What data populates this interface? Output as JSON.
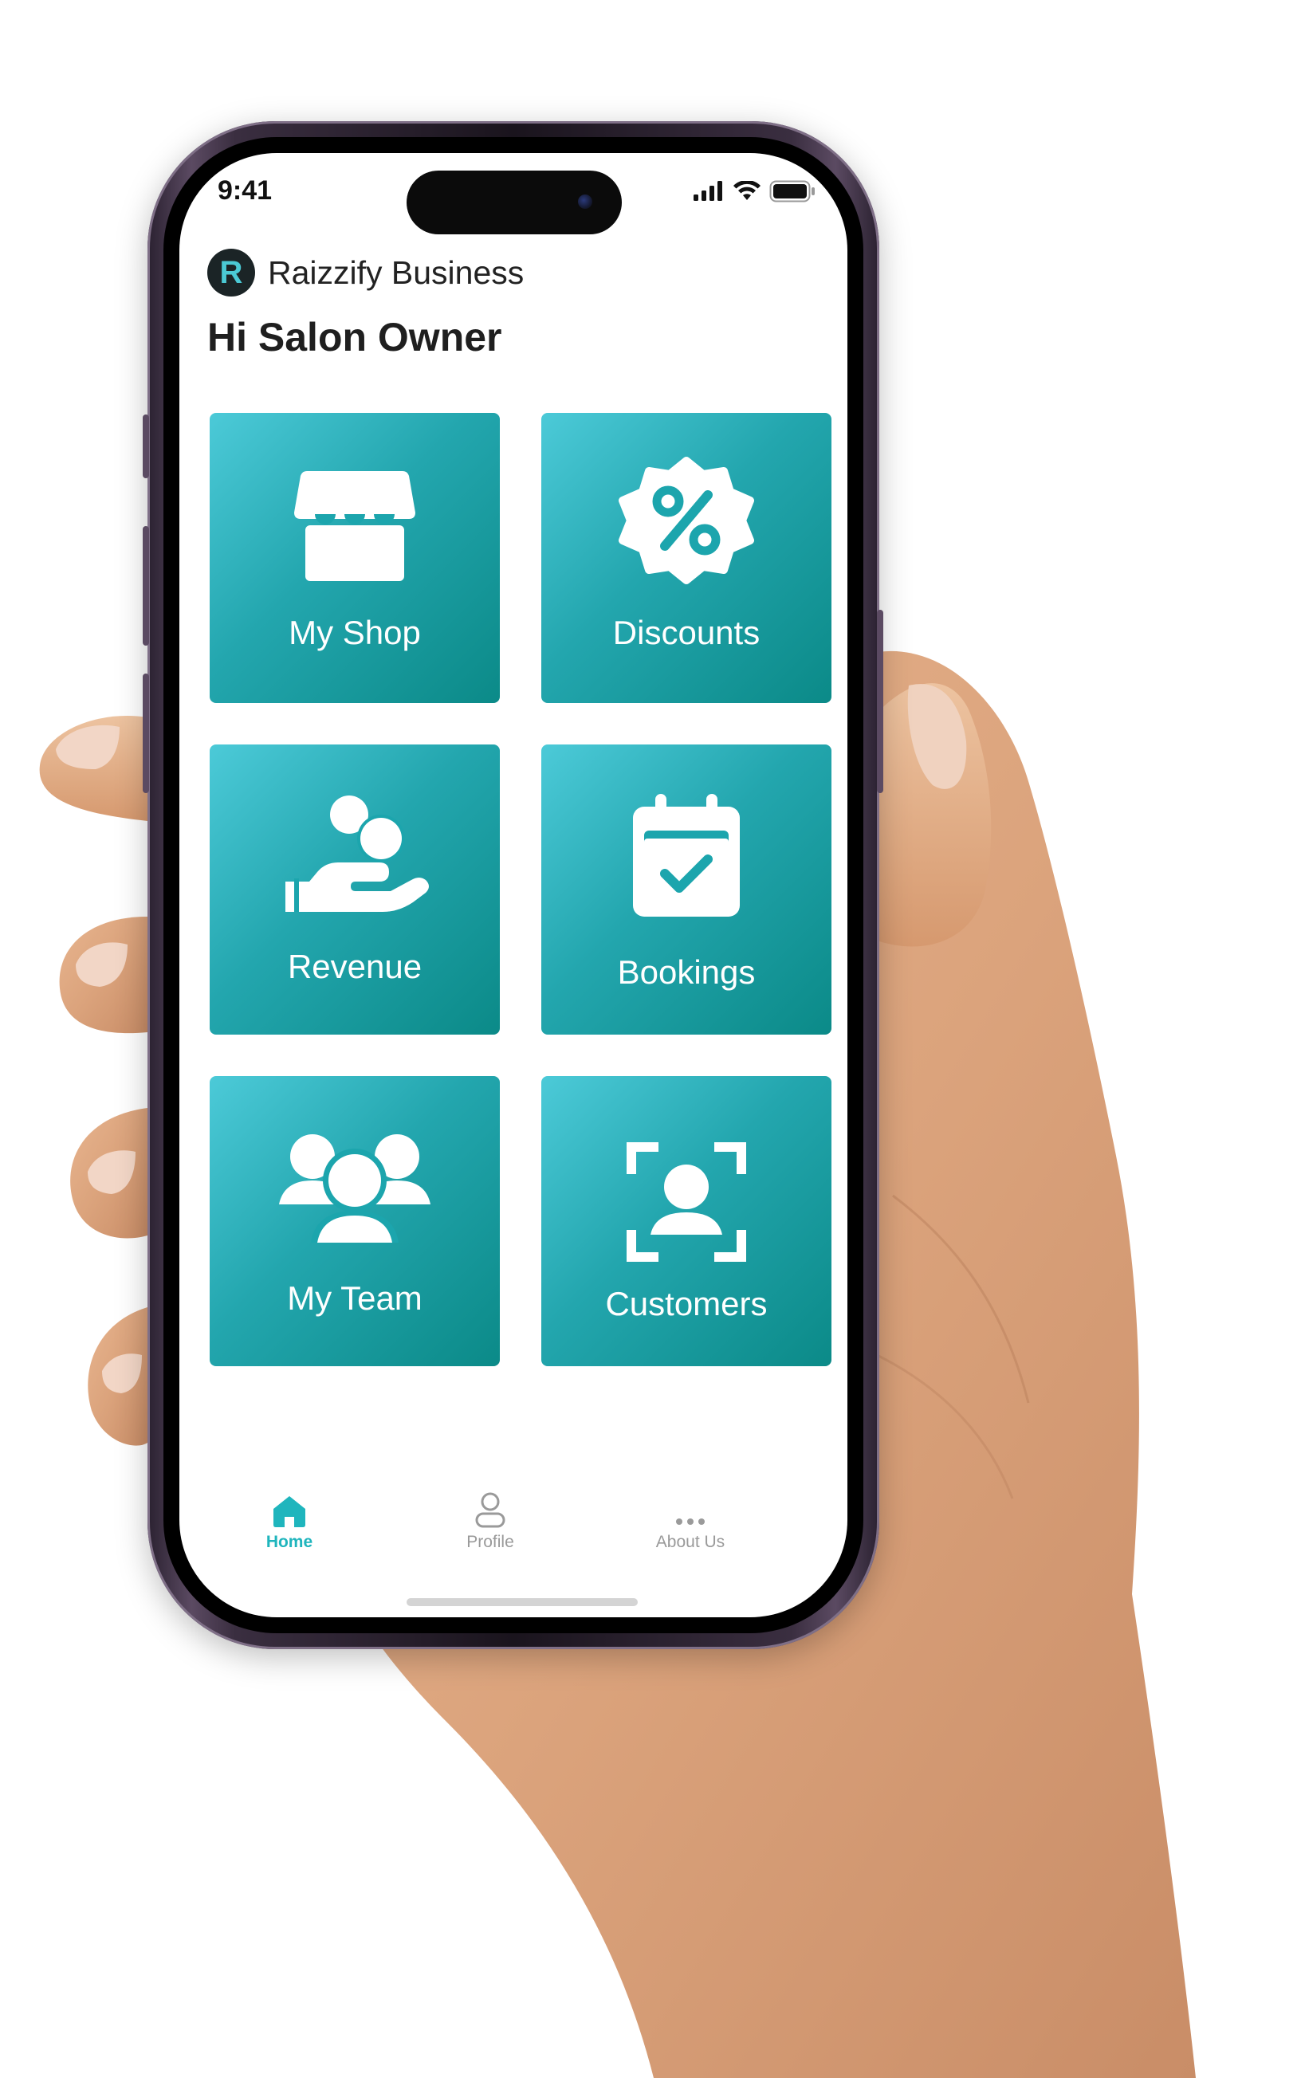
{
  "status_bar": {
    "time": "9:41"
  },
  "header": {
    "brand_letter": "R",
    "brand_name": "Raizzify Business",
    "greeting": "Hi Salon Owner"
  },
  "tiles": [
    {
      "label": "My Shop",
      "icon": "shop-icon"
    },
    {
      "label": "Discounts",
      "icon": "discount-badge-icon"
    },
    {
      "label": "Revenue",
      "icon": "hand-coins-icon"
    },
    {
      "label": "Bookings",
      "icon": "calendar-check-icon"
    },
    {
      "label": "My Team",
      "icon": "team-icon"
    },
    {
      "label": "Customers",
      "icon": "customer-scan-icon"
    }
  ],
  "tab_bar": {
    "items": [
      {
        "label": "Home",
        "icon": "home-icon",
        "active": true
      },
      {
        "label": "Profile",
        "icon": "profile-icon",
        "active": false
      },
      {
        "label": "About Us",
        "icon": "more-dots-icon",
        "active": false
      }
    ]
  },
  "colors": {
    "accent": "#1fb5bd",
    "tile_gradient_start": "#4ccad8",
    "tile_gradient_end": "#0b8a88",
    "inactive_tab": "#9a9a9a"
  }
}
